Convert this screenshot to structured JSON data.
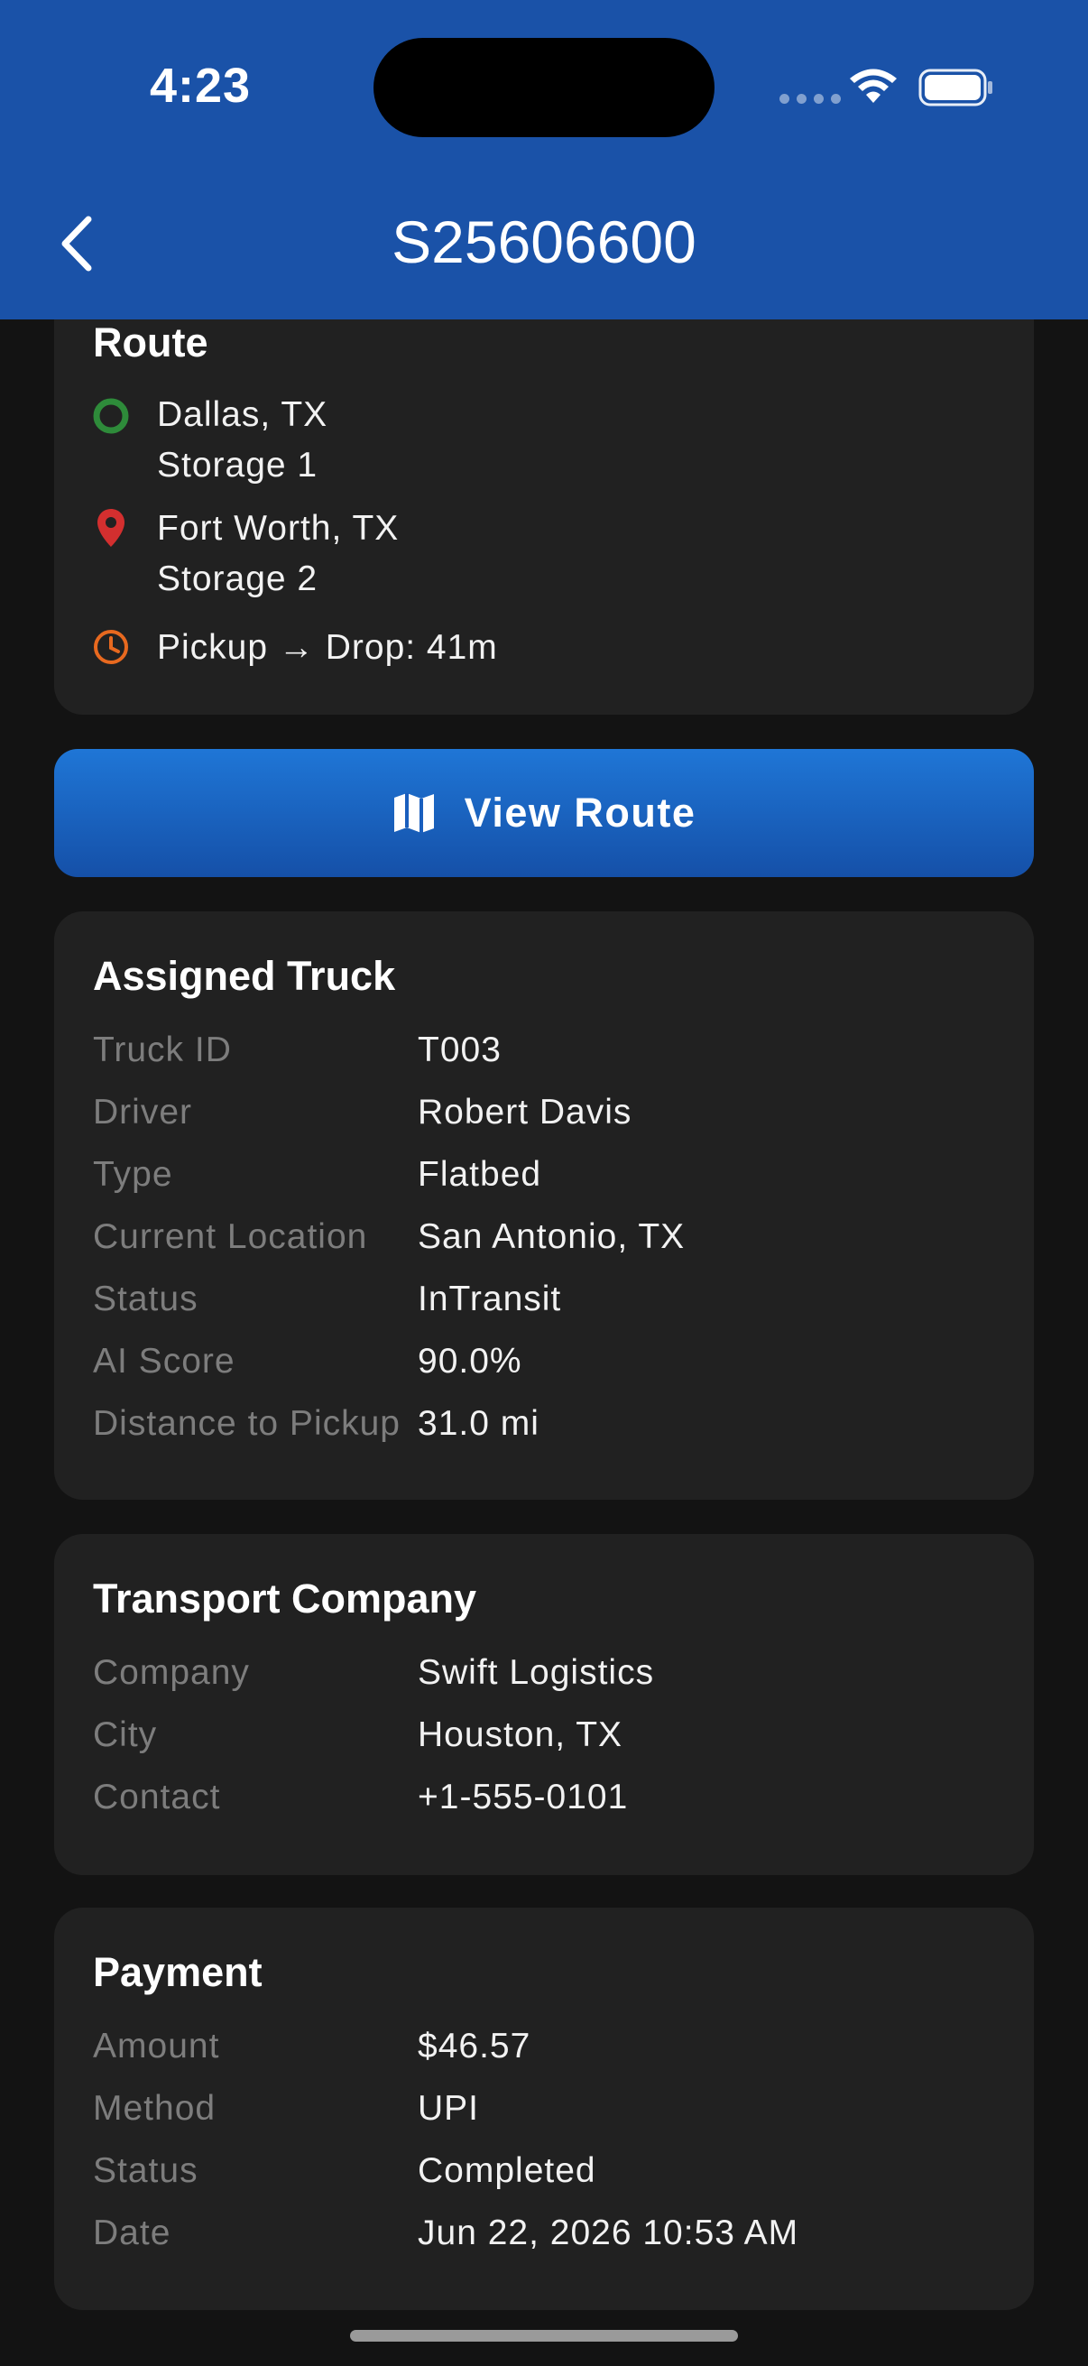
{
  "status_bar": {
    "time": "4:23"
  },
  "header": {
    "title": "S25606600",
    "back_icon": "chevron-left-icon"
  },
  "route": {
    "title": "Route",
    "origin": {
      "city": "Dallas, TX",
      "place": "Storage 1",
      "icon": "origin-circle-icon",
      "color": "#2e8b3a"
    },
    "destination": {
      "city": "Fort Worth, TX",
      "place": "Storage 2",
      "icon": "map-pin-icon",
      "color": "#d32f2f"
    },
    "duration": {
      "text": "Pickup → Drop: 41m",
      "icon": "clock-icon",
      "color": "#e8691f"
    }
  },
  "view_route_button": {
    "label": "View Route",
    "icon": "map-icon"
  },
  "truck": {
    "title": "Assigned Truck",
    "rows": [
      {
        "label": "Truck ID",
        "value": "T003"
      },
      {
        "label": "Driver",
        "value": "Robert Davis"
      },
      {
        "label": "Type",
        "value": "Flatbed"
      },
      {
        "label": "Current Location",
        "value": "San Antonio, TX"
      },
      {
        "label": "Status",
        "value": "InTransit"
      },
      {
        "label": "AI Score",
        "value": "90.0%"
      },
      {
        "label": "Distance to Pickup",
        "value": "31.0 mi"
      }
    ]
  },
  "company": {
    "title": "Transport Company",
    "rows": [
      {
        "label": "Company",
        "value": "Swift Logistics"
      },
      {
        "label": "City",
        "value": "Houston, TX"
      },
      {
        "label": "Contact",
        "value": "+1-555-0101"
      }
    ]
  },
  "payment": {
    "title": "Payment",
    "rows": [
      {
        "label": "Amount",
        "value": "$46.57"
      },
      {
        "label": "Method",
        "value": "UPI"
      },
      {
        "label": "Status",
        "value": "Completed"
      },
      {
        "label": "Date",
        "value": "Jun 22, 2026 10:53 AM"
      }
    ]
  },
  "colors": {
    "header": "#1a52a8",
    "background": "#131313",
    "card": "#212121",
    "button_top": "#1f76d6",
    "button_bottom": "#1550a8"
  }
}
